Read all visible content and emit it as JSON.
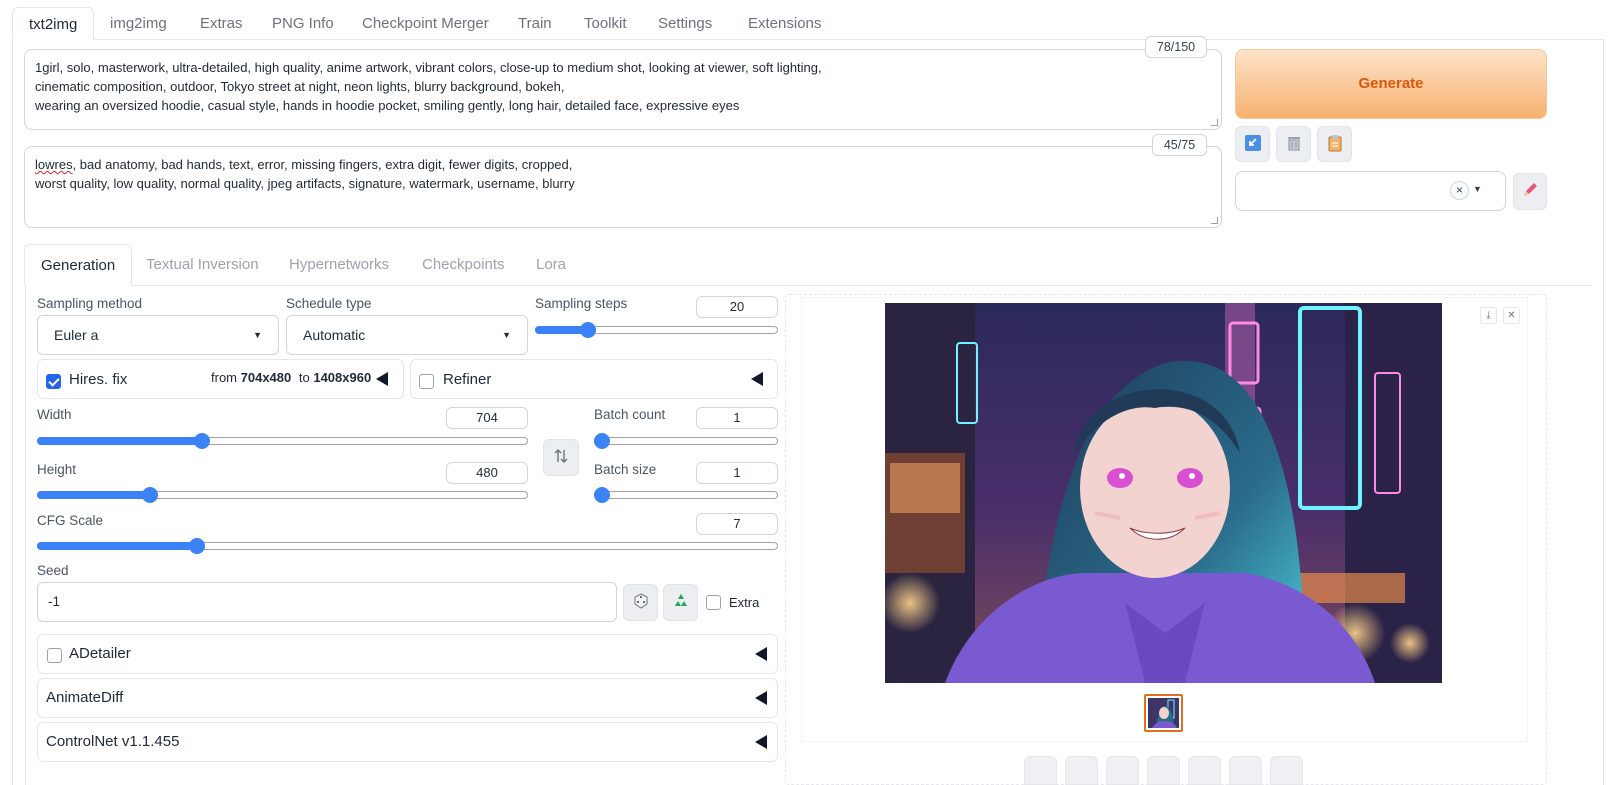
{
  "tabs": [
    "txt2img",
    "img2img",
    "Extras",
    "PNG Info",
    "Checkpoint Merger",
    "Train",
    "Toolkit",
    "Settings",
    "Extensions"
  ],
  "prompt": {
    "lines": [
      "1girl, solo, masterwork, ultra-detailed, high quality, anime artwork, vibrant colors, close-up to medium shot, looking at viewer, soft lighting,",
      "cinematic composition, outdoor, Tokyo street at night, neon lights, blurry background, bokeh,",
      "wearing an oversized hoodie, casual style, hands in hoodie pocket, smiling gently, long hair, detailed face, expressive eyes"
    ],
    "counter": "78/150"
  },
  "negative": {
    "first_word": "lowres",
    "line1_rest": ", bad anatomy, bad hands, text, error, missing fingers, extra digit, fewer digits, cropped,",
    "line2": "worst quality, low quality, normal quality, jpeg artifacts, signature, watermark, username, blurry",
    "counter": "45/75"
  },
  "generate_label": "Generate",
  "sub_tabs": [
    "Generation",
    "Textual Inversion",
    "Hypernetworks",
    "Checkpoints",
    "Lora"
  ],
  "sampling": {
    "method_label": "Sampling method",
    "method_value": "Euler a",
    "schedule_label": "Schedule type",
    "schedule_value": "Automatic",
    "steps_label": "Sampling steps",
    "steps_value": "20",
    "steps_fraction": 0.2
  },
  "hires": {
    "label": "Hires. fix",
    "from_text": "from",
    "from_value": "704x480",
    "to_text": "to",
    "to_value": "1408x960",
    "checked": true
  },
  "refiner": {
    "label": "Refiner",
    "checked": false
  },
  "width": {
    "label": "Width",
    "value": "704",
    "fraction": 0.33
  },
  "height": {
    "label": "Height",
    "value": "480",
    "fraction": 0.22
  },
  "batch_count": {
    "label": "Batch count",
    "value": "1",
    "fraction": 0.0
  },
  "batch_size": {
    "label": "Batch size",
    "value": "1",
    "fraction": 0.0
  },
  "cfg": {
    "label": "CFG Scale",
    "value": "7",
    "fraction": 0.21
  },
  "seed": {
    "label": "Seed",
    "value": "-1",
    "extra_label": "Extra"
  },
  "accordions": {
    "adetailer": "ADetailer",
    "animatediff": "AnimateDiff",
    "controlnet": "ControlNet v1.1.455"
  },
  "icons": {
    "swap": "swap-dimensions-icon",
    "dice": "dice-icon",
    "recycle": "recycle-icon",
    "pencil": "pencil-icon",
    "download": "download-icon",
    "close": "close-icon",
    "trash": "trash-icon",
    "clipboard": "clipboard-icon",
    "arrow": "read-params-icon"
  },
  "colors": {
    "accent": "#3b82f6",
    "generate_text": "#d9590f",
    "thumb_border": "#e0701f"
  }
}
